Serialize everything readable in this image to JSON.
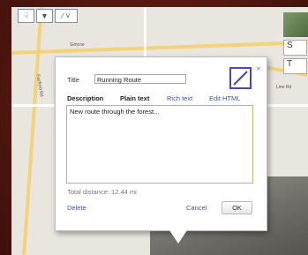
{
  "map": {
    "street_labels": [
      "Simcoe",
      "Fairfield Rd",
      "Line Rd"
    ]
  },
  "toolbar": {
    "hand_icon": "hand-icon",
    "marker_icon": "marker-icon",
    "line_icon": "line-icon",
    "hand_glyph": "☟",
    "marker_glyph": "▼",
    "line_glyph": "∕ ˅"
  },
  "right_panel": {
    "buttons": [
      "S",
      "T"
    ]
  },
  "popup": {
    "title_label": "Title",
    "title_value": "Running Route",
    "description_label": "Description",
    "tabs": [
      "Plain text",
      "Rich text",
      "Edit HTML"
    ],
    "description_value": "New route through the forest...",
    "total_distance": "Total distance: 12.44 mi",
    "delete_label": "Delete",
    "cancel_label": "Cancel",
    "ok_label": "OK",
    "close_glyph": "×",
    "line_style_icon": "line-style-icon",
    "accent_color": "#4b44c8"
  }
}
